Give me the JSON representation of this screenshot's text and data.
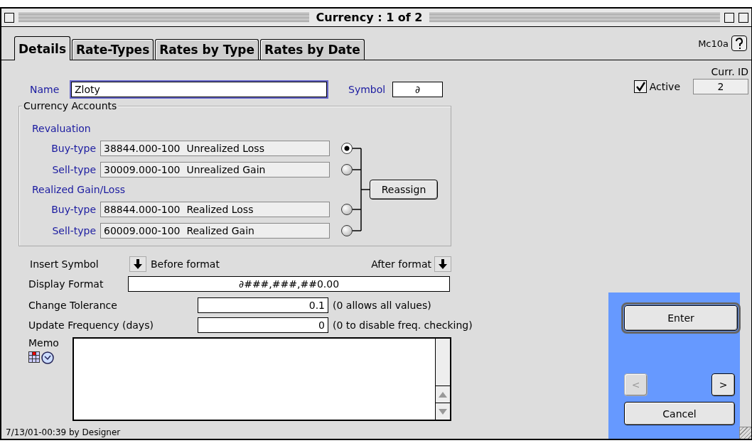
{
  "window": {
    "title": "Currency : 1 of 2"
  },
  "tabs": [
    {
      "label": "Details",
      "selected": true
    },
    {
      "label": "Rate-Types",
      "selected": false
    },
    {
      "label": "Rates by Type",
      "selected": false
    },
    {
      "label": "Rates by Date",
      "selected": false
    }
  ],
  "form_code": "Mc10a",
  "name": {
    "label": "Name",
    "value": "Zloty"
  },
  "symbol": {
    "label": "Symbol",
    "value": "∂"
  },
  "curr_id": {
    "label": "Curr. ID",
    "value": "2"
  },
  "active": {
    "label": "Active",
    "checked": true
  },
  "currency_accounts": {
    "title": "Currency Accounts",
    "button": "Reassign",
    "groups": [
      {
        "title": "Revaluation",
        "rows": [
          {
            "label": "Buy-type",
            "value": "38844.000-100  Unrealized Loss",
            "selected": true
          },
          {
            "label": "Sell-type",
            "value": "30009.000-100  Unrealized Gain",
            "selected": false
          }
        ]
      },
      {
        "title": "Realized Gain/Loss",
        "rows": [
          {
            "label": "Buy-type",
            "value": "88844.000-100  Realized Loss",
            "selected": false
          },
          {
            "label": "Sell-type",
            "value": "60009.000-100  Realized Gain",
            "selected": false
          }
        ]
      }
    ]
  },
  "insert_symbol": {
    "label": "Insert Symbol",
    "before": "Before format",
    "after": "After format"
  },
  "display_format": {
    "label": "Display Format",
    "value": "∂###,###,##0.00"
  },
  "change_tolerance": {
    "label": "Change Tolerance",
    "value": "0.1",
    "note": "(0 allows all values)"
  },
  "update_frequency": {
    "label": "Update Frequency (days)",
    "value": "0",
    "note": "(0 to disable freq. checking)"
  },
  "memo": {
    "label": "Memo"
  },
  "buttons": {
    "enter": "Enter",
    "previous": {
      "label": "<",
      "disabled": true
    },
    "next": {
      "label": ">",
      "disabled": false
    },
    "cancel": "Cancel"
  },
  "status": "7/13/01-00:39 by Designer"
}
